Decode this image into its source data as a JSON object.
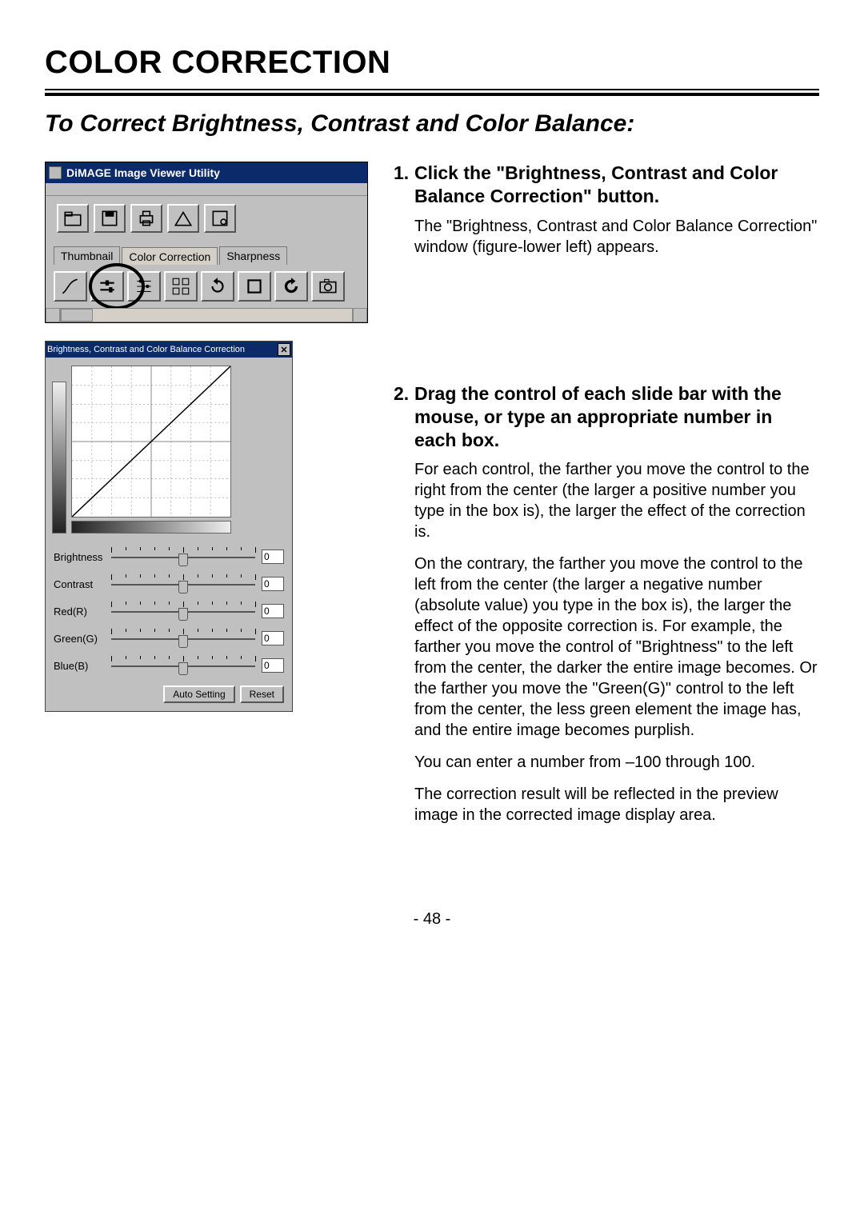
{
  "heading": "COLOR CORRECTION",
  "subtitle": "To Correct Brightness, Contrast and Color Balance:",
  "page_number": "- 48 -",
  "figA": {
    "title": "DiMAGE Image Viewer Utility",
    "toolbar1": [
      "open-folder-icon",
      "save-icon",
      "print-icon",
      "export-icon",
      "window-icon"
    ],
    "tabs": [
      "Thumbnail",
      "Color Correction",
      "Sharpness"
    ],
    "active_tab_index": 1,
    "toolbar2": [
      "curves-icon",
      "bcc-icon",
      "levels-icon",
      "variations-icon",
      "rotate-left-icon",
      "crop-icon",
      "undo-icon",
      "camera-icon"
    ]
  },
  "figB": {
    "title": "Brightness, Contrast and Color Balance Correction",
    "sliders": [
      {
        "label": "Brightness",
        "value": "0"
      },
      {
        "label": "Contrast",
        "value": "0"
      },
      {
        "label": "Red(R)",
        "value": "0"
      },
      {
        "label": "Green(G)",
        "value": "0"
      },
      {
        "label": "Blue(B)",
        "value": "0"
      }
    ],
    "buttons": {
      "auto": "Auto Setting",
      "reset": "Reset"
    }
  },
  "steps": {
    "s1": {
      "num": "1.",
      "title": "Click the \"Brightness, Contrast and Color Balance Correction\" button.",
      "p1": "The \"Brightness, Contrast and Color Balance Correction\" window (figure-lower left) appears."
    },
    "s2": {
      "num": "2.",
      "title": "Drag the control of each slide bar with the mouse, or type an appropriate number in each box.",
      "p1": "For each control, the farther you move the control to the right from the center (the larger a positive number you type in the box is), the larger the effect of the correction is.",
      "p2": "On the contrary, the farther you move the control to the left from the center (the larger a negative number (absolute value) you type in the box is), the larger the effect of the opposite correction is. For example, the farther you move the control of \"Brightness\" to the left from the center, the darker the entire image becomes. Or the farther you move the \"Green(G)\" control to the left from the center, the less green element the image has, and the entire image becomes purplish.",
      "p3": "You can enter a number from –100 through 100.",
      "p4": "The correction result will be reflected in the preview image in the corrected image display area."
    }
  }
}
